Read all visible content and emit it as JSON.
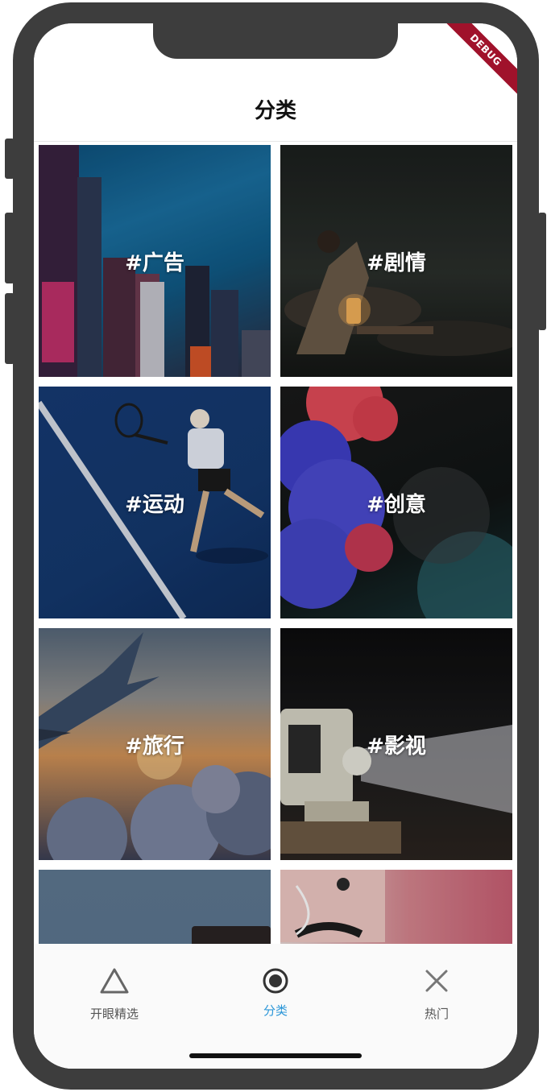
{
  "debug_banner": "DEBUG",
  "appbar": {
    "title": "分类"
  },
  "categories": [
    {
      "label": "#广告"
    },
    {
      "label": "#剧情"
    },
    {
      "label": "#运动"
    },
    {
      "label": "#创意"
    },
    {
      "label": "#旅行"
    },
    {
      "label": "#影视"
    },
    {
      "label": ""
    },
    {
      "label": ""
    }
  ],
  "tabs": [
    {
      "label": "开眼精选",
      "icon": "triangle-icon"
    },
    {
      "label": "分类",
      "icon": "radio-dot-icon",
      "active": true
    },
    {
      "label": "热门",
      "icon": "x-icon"
    }
  ],
  "colors": {
    "accent": "#2a96d8",
    "frame": "#3d3d3d",
    "debug": "#a0122b"
  }
}
